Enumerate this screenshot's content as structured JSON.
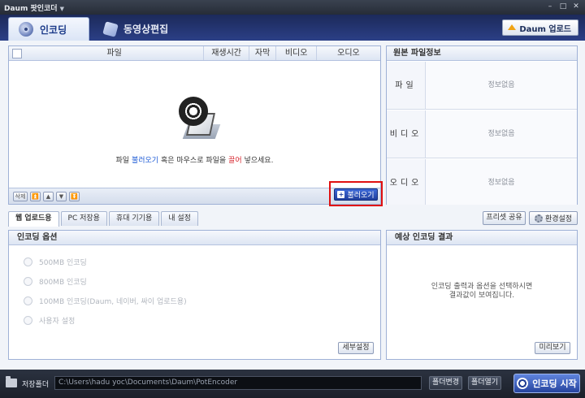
{
  "window": {
    "title": "Daum 팟인코더",
    "menu_caret": "▼"
  },
  "main_tabs": [
    {
      "label": "인코딩"
    },
    {
      "label": "동영상편집"
    }
  ],
  "upload_button": {
    "label": "Daum 업로드"
  },
  "file_list": {
    "columns": [
      "파일",
      "재생시간",
      "자막",
      "비디오",
      "오디오"
    ],
    "drop_message": {
      "prefix": "파일 ",
      "open_link": "불러오기",
      "middle": " 혹은 마우스로 파일을 ",
      "drag_link": "끌어",
      "suffix": " 넣으세요."
    },
    "delete_label": "삭제",
    "arrows": [
      "⏫",
      "▲",
      "▼",
      "⏬"
    ],
    "load_button": "불러오기"
  },
  "source_info": {
    "title": "원본 파일정보",
    "rows": [
      {
        "label": "파일",
        "value": "정보없음"
      },
      {
        "label": "비디오",
        "value": "정보없음"
      },
      {
        "label": "오디오",
        "value": "정보없음"
      }
    ]
  },
  "preset_tabs": [
    "웹 업로드용",
    "PC 저장용",
    "휴대 기기용",
    "내 설정"
  ],
  "preset_share_label": "프리셋 공유",
  "env_settings_label": "환경설정",
  "encoding_options": {
    "title": "인코딩 옵션",
    "options": [
      "500MB 인코딩",
      "800MB 인코딩",
      "100MB 인코딩(Daum, 네이버, 싸이 업로드용)",
      "사용자 설정"
    ],
    "detail_button": "세부설정"
  },
  "result": {
    "title": "예상 인코딩 결과",
    "message_line1": "인코딩 출력과 옵션을 선택하시면",
    "message_line2": "결과값이 보여집니다.",
    "preview_button": "미리보기"
  },
  "bottom": {
    "save_folder_label": "저장폴더",
    "path": "C:\\Users\\hadu yoc\\Documents\\Daum\\PotEncoder",
    "change_folder_button": "폴더변경",
    "open_folder_button": "폴더열기",
    "start_button": "인코딩 시작"
  }
}
